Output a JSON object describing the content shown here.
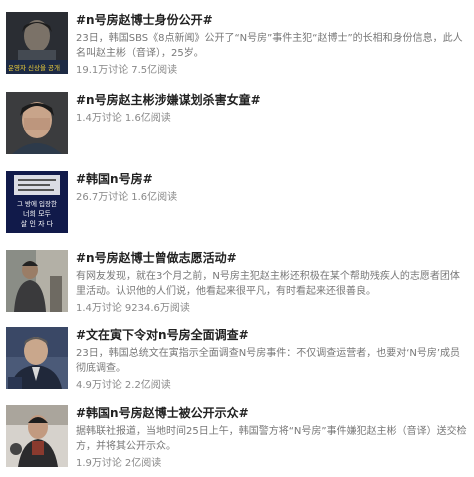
{
  "items": [
    {
      "title": "#n号房赵博士身份公开#",
      "summary": "23日，韩国SBS《8点新闻》公开了“N号房”事件主犯“赵博士”的长相和身份信息，此人名叫赵主彬（音译），25岁。",
      "discuss": "19.1万讨论",
      "reads": "7.5亿阅读",
      "thumb_text": "운영자 신상을 공개"
    },
    {
      "title": "#n号房赵主彬涉嫌谋划杀害女童#",
      "summary": "",
      "discuss": "1.4万讨论",
      "reads": "1.6亿阅读"
    },
    {
      "title": "#韩国n号房#",
      "summary": "",
      "discuss": "26.7万讨论",
      "reads": "1.6亿阅读",
      "thumb_text_lines": [
        "그 방에 입장한",
        "너희 모두",
        "살 인 자 다"
      ]
    },
    {
      "title": "#n号房赵博士曾做志愿活动#",
      "summary": "有网友发现，就在3个月之前，N号房主犯赵主彬还积极在某个帮助残疾人的志愿者团体里活动。认识他的人们说，他看起来很平凡，有时看起来还很善良。",
      "discuss": "1.4万讨论",
      "reads": "9234.6万阅读"
    },
    {
      "title": "#文在寅下令对n号房全面调查#",
      "summary": "23日，韩国总统文在寅指示全面调查N号房事件：不仅调查运营者，也要对‘N号房’成员彻底调查。",
      "discuss": "4.9万讨论",
      "reads": "2.2亿阅读"
    },
    {
      "title": "#韩国n号房赵博士被公开示众#",
      "summary": "据韩联社报道，当地时间25日上午，韩国警方将“N号房”事件嫌犯赵主彬（音译）送交检方，并将其公开示众。",
      "discuss": "1.9万讨论",
      "reads": "2亿阅读"
    }
  ]
}
